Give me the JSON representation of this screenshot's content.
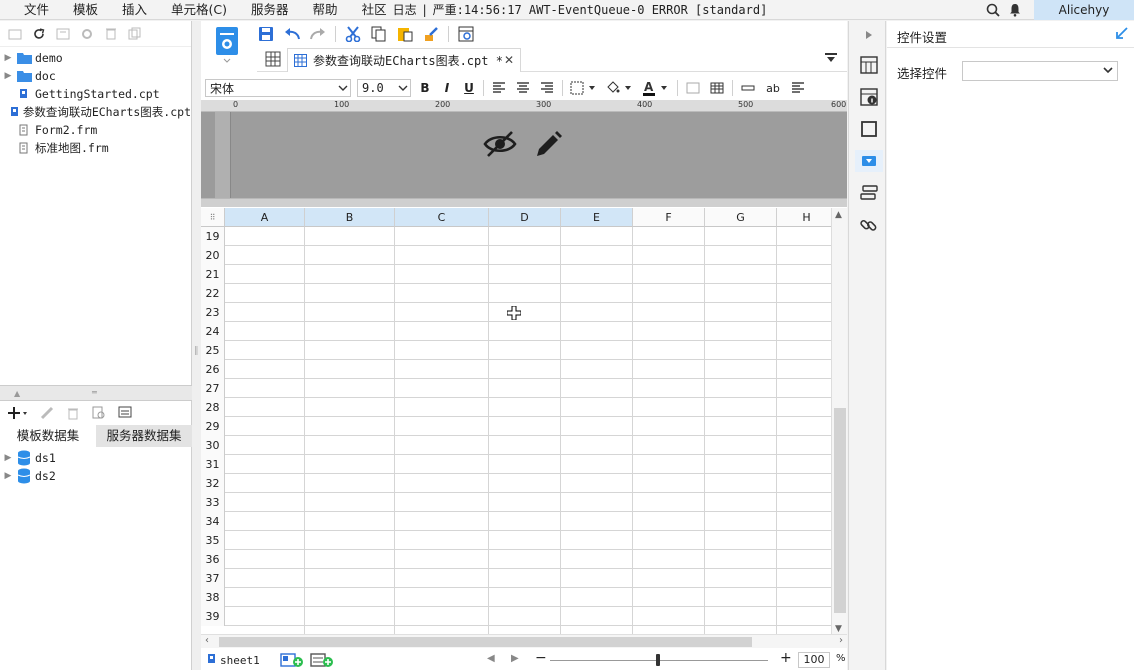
{
  "menubar": {
    "items": [
      "文件",
      "模板",
      "插入",
      "单元格(C)",
      "服务器",
      "帮助",
      "社区"
    ],
    "log_label": "日志",
    "log_message": "严重:14:56:17 AWT-EventQueue-0 ERROR [standard]",
    "user": "Alicehyy"
  },
  "left_panel": {
    "tree": [
      {
        "label": "demo",
        "type": "folder",
        "expandable": true
      },
      {
        "label": "doc",
        "type": "folder",
        "expandable": true
      },
      {
        "label": "GettingStarted.cpt",
        "type": "cpt",
        "expandable": false
      },
      {
        "label": "参数查询联动ECharts图表.cpt",
        "type": "cpt",
        "expandable": false
      },
      {
        "label": "Form2.frm",
        "type": "frm",
        "expandable": false
      },
      {
        "label": "标准地图.frm",
        "type": "frm",
        "expandable": false
      }
    ],
    "ds_tabs": [
      "模板数据集",
      "服务器数据集"
    ],
    "datasets": [
      "ds1",
      "ds2"
    ]
  },
  "editor": {
    "tab_label": "参数查询联动ECharts图表.cpt *",
    "font_family_value": "宋体",
    "font_size_value": "9.0",
    "format_buttons": [
      "B",
      "I",
      "U"
    ],
    "abc_label": "ab",
    "ruler_ticks": [
      "0",
      "100",
      "200",
      "300",
      "400",
      "500",
      "600"
    ],
    "columns": [
      {
        "label": "A",
        "selected": true
      },
      {
        "label": "B",
        "selected": true
      },
      {
        "label": "C",
        "selected": true
      },
      {
        "label": "D",
        "selected": true
      },
      {
        "label": "E",
        "selected": true
      },
      {
        "label": "F",
        "selected": false
      },
      {
        "label": "G",
        "selected": false
      },
      {
        "label": "H",
        "selected": false
      }
    ],
    "rows": [
      "19",
      "20",
      "21",
      "22",
      "23",
      "24",
      "25",
      "26",
      "27",
      "28",
      "29",
      "30",
      "31",
      "32",
      "33",
      "34",
      "35",
      "36",
      "37",
      "38",
      "39"
    ],
    "sheet_name": "sheet1",
    "zoom_value": "100",
    "zoom_unit": "%"
  },
  "settings": {
    "title": "控件设置",
    "select_label": "选择控件",
    "select_value": ""
  },
  "colors": {
    "accent": "#2d8ee8",
    "selected_header": "#d2e6f7",
    "user_bg": "#cfe4f7",
    "design_gray": "#9d9d9d"
  }
}
